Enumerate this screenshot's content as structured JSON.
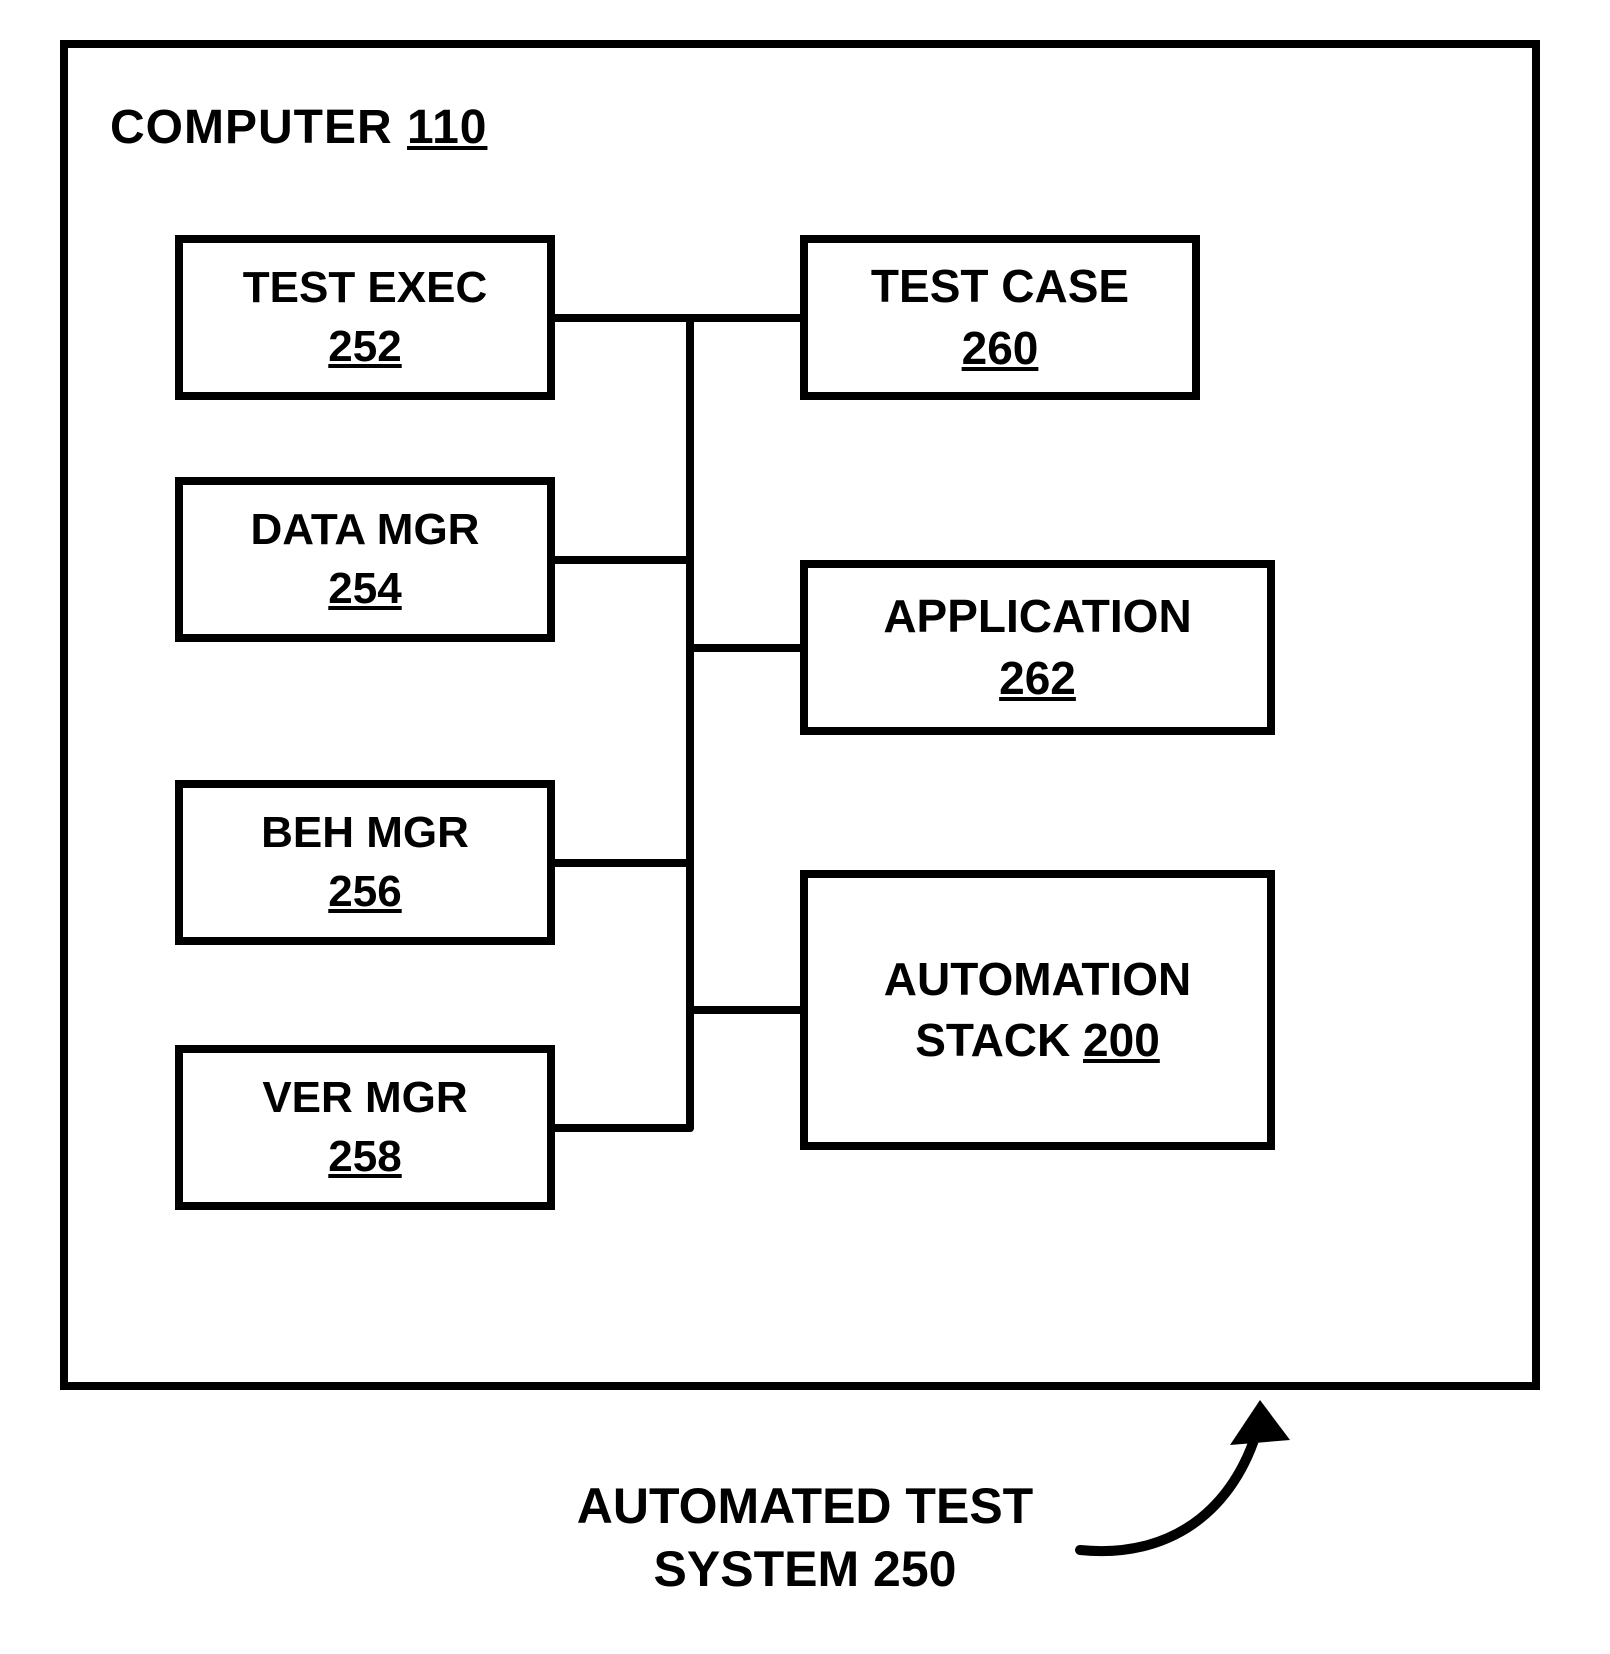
{
  "title": {
    "label": "COMPUTER",
    "num": "110"
  },
  "nodes": {
    "test_exec": {
      "name": "TEST EXEC",
      "num": "252"
    },
    "data_mgr": {
      "name": "DATA MGR",
      "num": "254"
    },
    "beh_mgr": {
      "name": "BEH MGR",
      "num": "256"
    },
    "ver_mgr": {
      "name": "VER MGR",
      "num": "258"
    },
    "test_case": {
      "name": "TEST CASE",
      "num": "260"
    },
    "application": {
      "name": "APPLICATION",
      "num": "262"
    },
    "automation_stack": {
      "line1": "AUTOMATION",
      "line2_prefix": "STACK",
      "num": "200"
    }
  },
  "caption": {
    "line1": "AUTOMATED TEST",
    "line2": "SYSTEM 250"
  }
}
